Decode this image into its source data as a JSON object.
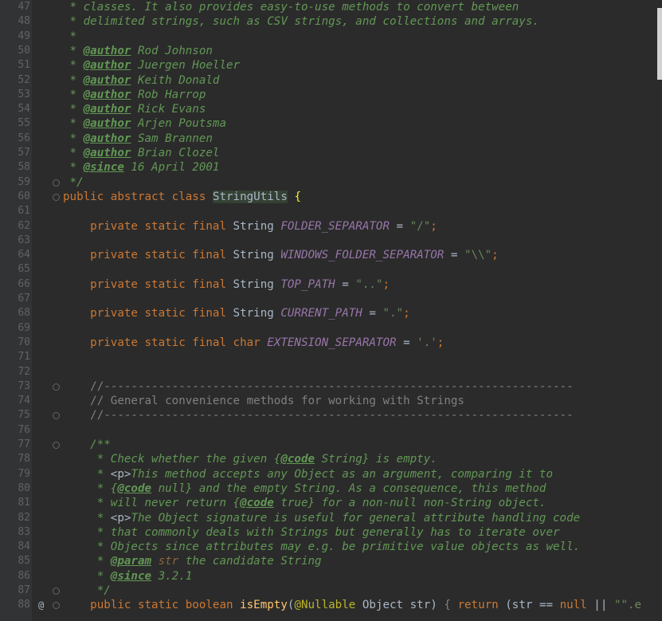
{
  "editor": {
    "lines": [
      {
        "n": "47",
        "parts": [
          {
            "c": "doc",
            "t": " * classes. It also provides easy-to-use methods to convert between"
          }
        ]
      },
      {
        "n": "48",
        "parts": [
          {
            "c": "doc",
            "t": " * delimited strings, such as CSV strings, and collections and arrays."
          }
        ]
      },
      {
        "n": "49",
        "parts": [
          {
            "c": "doc",
            "t": " *"
          }
        ]
      },
      {
        "n": "50",
        "parts": [
          {
            "c": "doc",
            "t": " * "
          },
          {
            "c": "tag",
            "t": "@author"
          },
          {
            "c": "doc",
            "t": " Rod Johnson"
          }
        ]
      },
      {
        "n": "51",
        "parts": [
          {
            "c": "doc",
            "t": " * "
          },
          {
            "c": "tag",
            "t": "@author"
          },
          {
            "c": "doc",
            "t": " Juergen Hoeller"
          }
        ]
      },
      {
        "n": "52",
        "parts": [
          {
            "c": "doc",
            "t": " * "
          },
          {
            "c": "tag",
            "t": "@author"
          },
          {
            "c": "doc",
            "t": " Keith Donald"
          }
        ]
      },
      {
        "n": "53",
        "parts": [
          {
            "c": "doc",
            "t": " * "
          },
          {
            "c": "tag",
            "t": "@author"
          },
          {
            "c": "doc",
            "t": " Rob Harrop"
          }
        ]
      },
      {
        "n": "54",
        "parts": [
          {
            "c": "doc",
            "t": " * "
          },
          {
            "c": "tag",
            "t": "@author"
          },
          {
            "c": "doc",
            "t": " Rick Evans"
          }
        ]
      },
      {
        "n": "55",
        "parts": [
          {
            "c": "doc",
            "t": " * "
          },
          {
            "c": "tag",
            "t": "@author"
          },
          {
            "c": "doc",
            "t": " Arjen Poutsma"
          }
        ]
      },
      {
        "n": "56",
        "parts": [
          {
            "c": "doc",
            "t": " * "
          },
          {
            "c": "tag",
            "t": "@author"
          },
          {
            "c": "doc",
            "t": " Sam Brannen"
          }
        ]
      },
      {
        "n": "57",
        "parts": [
          {
            "c": "doc",
            "t": " * "
          },
          {
            "c": "tag",
            "t": "@author"
          },
          {
            "c": "doc",
            "t": " Brian Clozel"
          }
        ]
      },
      {
        "n": "58",
        "parts": [
          {
            "c": "doc",
            "t": " * "
          },
          {
            "c": "tag",
            "t": "@since"
          },
          {
            "c": "doc",
            "t": " 16 April 2001"
          }
        ]
      },
      {
        "n": "59",
        "parts": [
          {
            "c": "doc",
            "t": " */"
          }
        ]
      },
      {
        "n": "60",
        "parts": [
          {
            "c": "kw",
            "t": "public abstract class "
          },
          {
            "c": "cls",
            "t": "StringUtils"
          },
          {
            "c": "id",
            "t": " "
          },
          {
            "c": "brace",
            "t": "{"
          }
        ]
      },
      {
        "n": "61",
        "parts": []
      },
      {
        "n": "62",
        "parts": [
          {
            "c": "kw",
            "t": "    private static final "
          },
          {
            "c": "id",
            "t": "String "
          },
          {
            "c": "st",
            "t": "FOLDER_SEPARATOR"
          },
          {
            "c": "id",
            "t": " = "
          },
          {
            "c": "str",
            "t": "\"/\""
          },
          {
            "c": "kw",
            "t": ";"
          }
        ]
      },
      {
        "n": "63",
        "parts": []
      },
      {
        "n": "64",
        "parts": [
          {
            "c": "kw",
            "t": "    private static final "
          },
          {
            "c": "id",
            "t": "String "
          },
          {
            "c": "st",
            "t": "WINDOWS_FOLDER_SEPARATOR"
          },
          {
            "c": "id",
            "t": " = "
          },
          {
            "c": "str",
            "t": "\"\\\\\""
          },
          {
            "c": "kw",
            "t": ";"
          }
        ]
      },
      {
        "n": "65",
        "parts": []
      },
      {
        "n": "66",
        "parts": [
          {
            "c": "kw",
            "t": "    private static final "
          },
          {
            "c": "id",
            "t": "String "
          },
          {
            "c": "st",
            "t": "TOP_PATH"
          },
          {
            "c": "id",
            "t": " = "
          },
          {
            "c": "str",
            "t": "\"..\""
          },
          {
            "c": "kw",
            "t": ";"
          }
        ]
      },
      {
        "n": "67",
        "parts": []
      },
      {
        "n": "68",
        "parts": [
          {
            "c": "kw",
            "t": "    private static final "
          },
          {
            "c": "id",
            "t": "String "
          },
          {
            "c": "st",
            "t": "CURRENT_PATH"
          },
          {
            "c": "id",
            "t": " = "
          },
          {
            "c": "str",
            "t": "\".\""
          },
          {
            "c": "kw",
            "t": ";"
          }
        ]
      },
      {
        "n": "69",
        "parts": []
      },
      {
        "n": "70",
        "parts": [
          {
            "c": "kw",
            "t": "    private static final char "
          },
          {
            "c": "st",
            "t": "EXTENSION_SEPARATOR"
          },
          {
            "c": "id",
            "t": " = "
          },
          {
            "c": "str",
            "t": "'.'"
          },
          {
            "c": "kw",
            "t": ";"
          }
        ]
      },
      {
        "n": "71",
        "parts": []
      },
      {
        "n": "72",
        "parts": []
      },
      {
        "n": "73",
        "parts": [
          {
            "c": "cm",
            "t": "    //---------------------------------------------------------------------"
          }
        ]
      },
      {
        "n": "74",
        "parts": [
          {
            "c": "cm",
            "t": "    // General convenience methods for working with Strings"
          }
        ]
      },
      {
        "n": "75",
        "parts": [
          {
            "c": "cm",
            "t": "    //---------------------------------------------------------------------"
          }
        ]
      },
      {
        "n": "76",
        "parts": []
      },
      {
        "n": "77",
        "parts": [
          {
            "c": "doc",
            "t": "    /**"
          }
        ]
      },
      {
        "n": "78",
        "parts": [
          {
            "c": "doc",
            "t": "     * Check whether the given {"
          },
          {
            "c": "tag",
            "t": "@code"
          },
          {
            "c": "doc",
            "t": " String} is empty."
          }
        ]
      },
      {
        "n": "79",
        "parts": [
          {
            "c": "doc",
            "t": "     * "
          },
          {
            "c": "id",
            "t": "<p>"
          },
          {
            "c": "doc",
            "t": "This method accepts any Object as an argument, comparing it to"
          }
        ]
      },
      {
        "n": "80",
        "parts": [
          {
            "c": "doc",
            "t": "     * {"
          },
          {
            "c": "tag",
            "t": "@code"
          },
          {
            "c": "doc",
            "t": " null} and the empty String. As a consequence, this method"
          }
        ]
      },
      {
        "n": "81",
        "parts": [
          {
            "c": "doc",
            "t": "     * will never return {"
          },
          {
            "c": "tag",
            "t": "@code"
          },
          {
            "c": "doc",
            "t": " true} for a non-null non-String object."
          }
        ]
      },
      {
        "n": "82",
        "parts": [
          {
            "c": "doc",
            "t": "     * "
          },
          {
            "c": "id",
            "t": "<p>"
          },
          {
            "c": "doc",
            "t": "The Object signature is useful for general attribute handling code"
          }
        ]
      },
      {
        "n": "83",
        "parts": [
          {
            "c": "doc",
            "t": "     * that commonly deals with Strings but generally has to iterate over"
          }
        ]
      },
      {
        "n": "84",
        "parts": [
          {
            "c": "doc",
            "t": "     * Objects since attributes may e.g. be primitive value objects as well."
          }
        ]
      },
      {
        "n": "85",
        "parts": [
          {
            "c": "doc",
            "t": "     * "
          },
          {
            "c": "tag",
            "t": "@param"
          },
          {
            "c": "doc",
            "t": " "
          },
          {
            "c": "tagv",
            "t": "str"
          },
          {
            "c": "doc",
            "t": " the candidate String"
          }
        ]
      },
      {
        "n": "86",
        "parts": [
          {
            "c": "doc",
            "t": "     * "
          },
          {
            "c": "tag",
            "t": "@since"
          },
          {
            "c": "doc",
            "t": " 3.2.1"
          }
        ]
      },
      {
        "n": "87",
        "parts": [
          {
            "c": "doc",
            "t": "     */"
          }
        ]
      },
      {
        "n": "88",
        "parts": [
          {
            "c": "kw",
            "t": "    public static boolean "
          },
          {
            "c": "fn",
            "t": "isEmpty"
          },
          {
            "c": "id",
            "t": "("
          },
          {
            "c": "ann",
            "t": "@Nullable"
          },
          {
            "c": "id",
            "t": " Object str) "
          },
          {
            "c": "cm",
            "t": "{ "
          },
          {
            "c": "kw",
            "t": "return "
          },
          {
            "c": "id",
            "t": "(str == "
          },
          {
            "c": "kw",
            "t": "null"
          },
          {
            "c": "id",
            "t": " || "
          },
          {
            "c": "str",
            "t": "\"\".e"
          }
        ]
      }
    ]
  }
}
